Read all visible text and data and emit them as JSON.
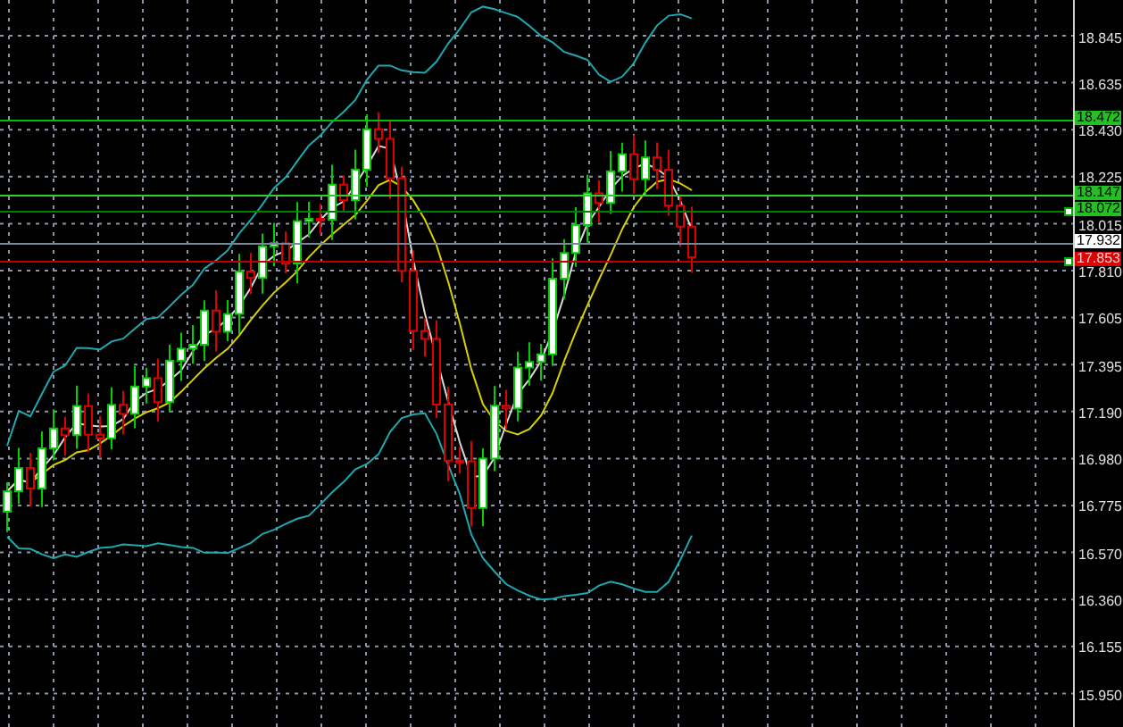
{
  "chart": {
    "price_axis": {
      "labels": [
        "18.845",
        "18.635",
        "18.430",
        "18.225",
        "18.015",
        "17.810",
        "17.605",
        "17.395",
        "17.190",
        "16.980",
        "16.775",
        "16.570",
        "16.360",
        "16.155",
        "15.950"
      ]
    },
    "levels": [
      {
        "price_tag": "18.472",
        "kind": "level",
        "color": "#00c000",
        "marker": false
      },
      {
        "price_tag": "18.147",
        "kind": "level",
        "color": "#32cd32",
        "marker": false
      },
      {
        "price_tag": "18.072",
        "kind": "level",
        "color": "#008000",
        "marker": true
      },
      {
        "price_tag": "17.932",
        "kind": "bid",
        "color": "#778899",
        "marker": false
      },
      {
        "price_tag": "17.853",
        "kind": "stop",
        "color": "#c00000",
        "marker": true
      }
    ]
  }
}
